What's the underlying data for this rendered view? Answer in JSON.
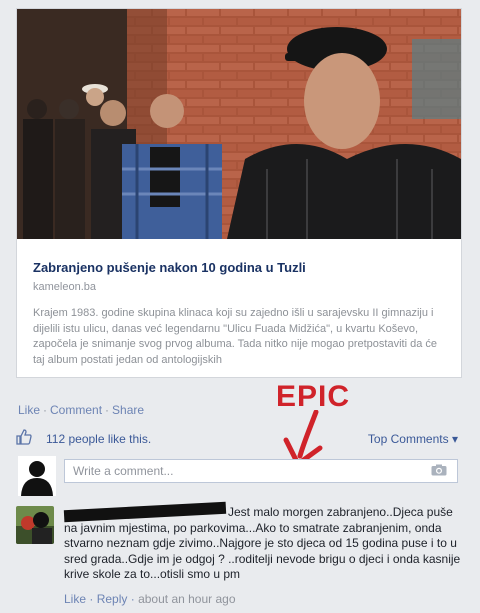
{
  "link_preview": {
    "title": "Zabranjeno pušenje nakon 10 godina u Tuzli",
    "domain": "kameleon.ba",
    "description": "Krajem 1983. godine skupina klinaca koji su zajedno išli u sarajevsku II gimnaziju i dijelili istu ulicu, danas već legendarnu \"Ulicu Fuada Midžića\", u kvartu Koševo, započela je snimanje svog prvog albuma. Tada nitko nije mogao pretpostaviti da će taj album postati jedan od antologijskih"
  },
  "actions": {
    "like": "Like",
    "comment": "Comment",
    "share": "Share",
    "separator": "·"
  },
  "annotation": {
    "text": "EPIC",
    "color": "#d0232a"
  },
  "likes": {
    "count_text": "112 people like this.",
    "sort_label": "Top Comments",
    "sort_icon": "caret-down"
  },
  "write_comment": {
    "placeholder": "Write a comment..."
  },
  "comment": {
    "text": "Jest malo morgen zabranjeno..Djeca puše na javnim mjestima, po parkovima...Ako to smatrate zabranjenim, onda stvarno neznam gdje zivimo..Najgore je sto djeca od 15 godina puse i to u sred grada..Gdje im je odgoj ? ..roditelji nevode brigu o djeci i onda kasnije krive skole za to...otisli smo u pm",
    "like": "Like",
    "reply": "Reply",
    "time": "about an hour ago",
    "separator": "·"
  },
  "colors": {
    "link_blue": "#3b5998",
    "background": "#e9ebee"
  }
}
